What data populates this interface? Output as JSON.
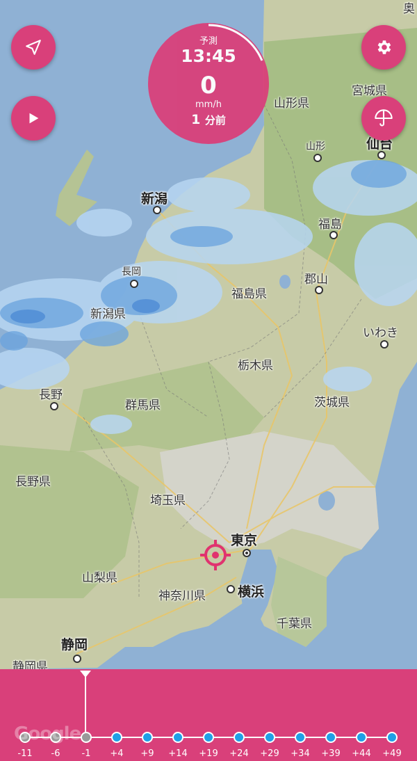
{
  "forecast": {
    "label": "予測",
    "time": "13:45",
    "value": "0",
    "unit": "mm/h",
    "ago_number": "1",
    "ago_suffix": "分前"
  },
  "buttons": {
    "location": "location-arrow-icon",
    "play": "play-icon",
    "settings": "gear-icon",
    "umbrella": "umbrella-icon"
  },
  "map": {
    "attribution": "Google",
    "labels": [
      {
        "text": "奥",
        "kind": "prefecture"
      },
      {
        "text": "宮城県",
        "kind": "prefecture"
      },
      {
        "text": "山形県",
        "kind": "prefecture"
      },
      {
        "text": "山形",
        "kind": "city-small"
      },
      {
        "text": "仙台",
        "kind": "city-big"
      },
      {
        "text": "新潟",
        "kind": "city-big"
      },
      {
        "text": "福島",
        "kind": "city"
      },
      {
        "text": "長岡",
        "kind": "city-small"
      },
      {
        "text": "郡山",
        "kind": "city"
      },
      {
        "text": "福島県",
        "kind": "prefecture"
      },
      {
        "text": "新潟県",
        "kind": "prefecture"
      },
      {
        "text": "いわき",
        "kind": "city"
      },
      {
        "text": "栃木県",
        "kind": "prefecture"
      },
      {
        "text": "長野",
        "kind": "city"
      },
      {
        "text": "茨城県",
        "kind": "prefecture"
      },
      {
        "text": "群馬県",
        "kind": "prefecture"
      },
      {
        "text": "長野県",
        "kind": "prefecture"
      },
      {
        "text": "埼玉県",
        "kind": "prefecture"
      },
      {
        "text": "東京",
        "kind": "city-big"
      },
      {
        "text": "山梨県",
        "kind": "prefecture"
      },
      {
        "text": "神奈川県",
        "kind": "prefecture"
      },
      {
        "text": "横浜",
        "kind": "city-big"
      },
      {
        "text": "千葉県",
        "kind": "prefecture"
      },
      {
        "text": "静岡",
        "kind": "city-big"
      },
      {
        "text": "静岡県",
        "kind": "prefecture"
      }
    ]
  },
  "timeline": {
    "ticks": [
      "-11",
      "-6",
      "-1",
      "+4",
      "+9",
      "+14",
      "+19",
      "+24",
      "+29",
      "+34",
      "+39",
      "+44",
      "+49"
    ],
    "selected": "-1",
    "past_count": 3
  },
  "colors": {
    "accent": "#d9407a",
    "past_dot": "#999999",
    "future_dot": "#1fa0e6",
    "sea": "#8fb1d4",
    "land": "#b9c6a0"
  }
}
